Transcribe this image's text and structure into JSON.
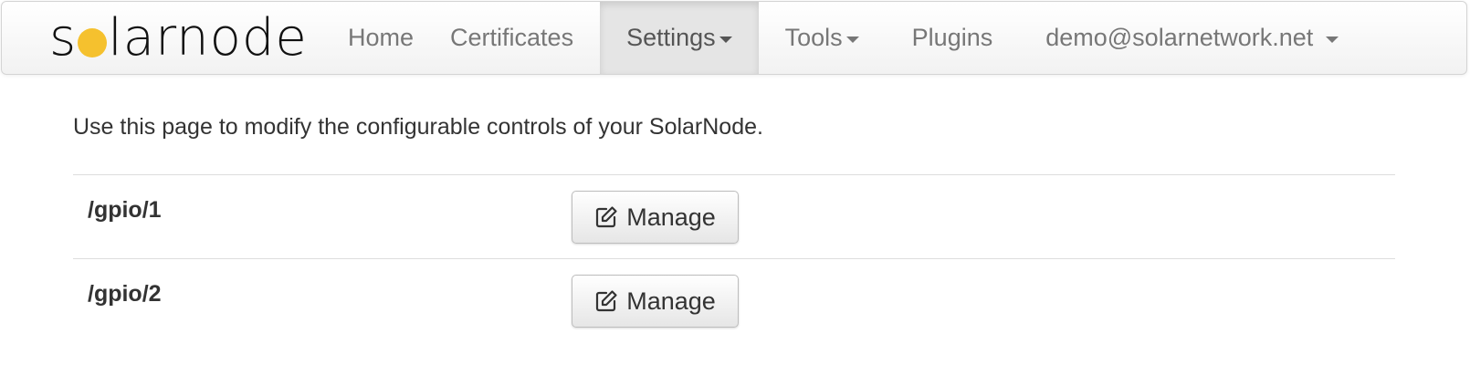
{
  "navbar": {
    "brand": {
      "before_sun": "s",
      "after_sun": "larnode",
      "sun_color": "#f5c12e"
    },
    "items": [
      {
        "label": "Home",
        "dropdown": false,
        "active": false
      },
      {
        "label": "Certificates",
        "dropdown": false,
        "active": false
      },
      {
        "label": "Settings",
        "dropdown": true,
        "active": true
      },
      {
        "label": "Tools",
        "dropdown": true,
        "active": false
      },
      {
        "label": "Plugins",
        "dropdown": false,
        "active": false
      },
      {
        "label": "demo@solarnetwork.net",
        "dropdown": true,
        "active": false
      }
    ]
  },
  "main": {
    "intro": "Use this page to modify the configurable controls of your SolarNode.",
    "controls": [
      {
        "id": "/gpio/1",
        "button_label": "Manage",
        "button_icon": "edit-icon"
      },
      {
        "id": "/gpio/2",
        "button_label": "Manage",
        "button_icon": "edit-icon"
      }
    ]
  }
}
